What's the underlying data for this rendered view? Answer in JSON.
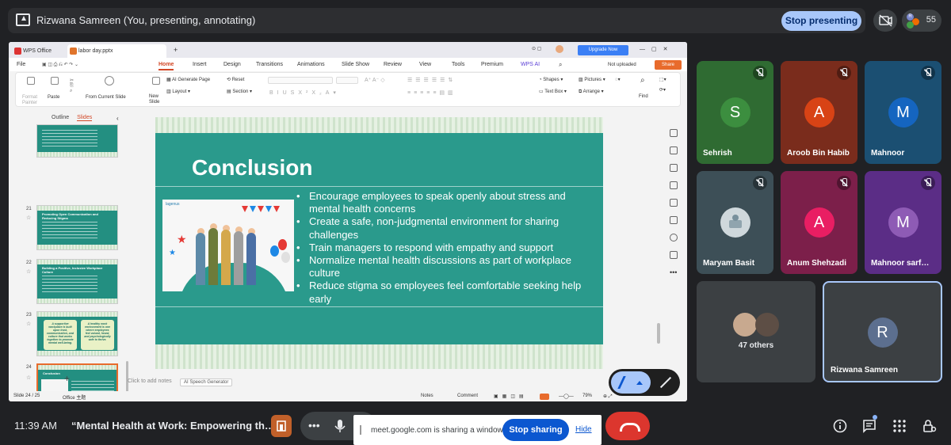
{
  "top": {
    "presenter_title": "Rizwana Samreen (You, presenting, annotating)",
    "stop_presenting": "Stop presenting",
    "participant_count": "55",
    "avatar_letter": "R"
  },
  "wps": {
    "tabs": [
      "WPS Office",
      "labor day.pptx"
    ],
    "upgrade": "Upgrade Now",
    "menu": [
      "File",
      "Home",
      "Insert",
      "Design",
      "Transitions",
      "Animations",
      "Slide Show",
      "Review",
      "View",
      "Tools",
      "Premium",
      "WPS AI"
    ],
    "not_uploaded": "Not uploaded",
    "share": "Share",
    "ribbon": {
      "format_painter": "Format Painter",
      "paste": "Paste",
      "from_current": "From Current Slide",
      "new_slide": "New Slide",
      "ai_generate": "AI Generate Page",
      "layout": "Layout",
      "reset": "Reset",
      "section": "Section",
      "shapes": "Shapes",
      "pictures": "Pictures",
      "text_box": "Text Box",
      "arrange": "Arrange",
      "find": "Find"
    },
    "panel_tabs": [
      "Outline",
      "Slides"
    ],
    "thumbs": [
      {
        "num": "21",
        "title": "Promoting Open Communication and Reducing Stigma"
      },
      {
        "num": "22",
        "title": "Building a Positive, Inclusive Workplace Culture"
      },
      {
        "num": "23",
        "q1": "A supportive workplace is built upon trust, communication, and culture that works together to promote mental well-being.",
        "q2": "A healthy work environment is one where employees feel valued, heard, and psychologically safe to thrive."
      },
      {
        "num": "24",
        "title": "Conclusion"
      }
    ],
    "notes_placeholder": "Click to add notes",
    "ai_speech": "AI Speech Generator",
    "status": {
      "slide": "Slide 24 / 25",
      "theme": "Office 主题",
      "notes": "Notes",
      "comment": "Comment",
      "zoom": "79%"
    }
  },
  "slide": {
    "title": "Conclusion",
    "bullets": [
      "Encourage employees to speak openly about stress and mental health concerns",
      "Create a safe, non-judgmental environment for sharing challenges",
      "Train managers to respond with empathy and support",
      "Normalize mental health discussions as part of workplace culture",
      "Reduce stigma so employees feel comfortable seeking help early"
    ],
    "illus_logo": "lagenus"
  },
  "tiles": [
    {
      "name": "Sehrish",
      "letter": "S",
      "bg": "#2f6b32",
      "av": "#3c8e3f"
    },
    {
      "name": "Aroob Bin Habib",
      "letter": "A",
      "bg": "#7a2c1c",
      "av": "#d84315"
    },
    {
      "name": "Mahnoor",
      "letter": "M",
      "bg": "#1b4f72",
      "av": "#1565c0"
    },
    {
      "name": "Maryam Basit",
      "letter": "",
      "bg": "#3d4f57",
      "av": "#cfd8dc"
    },
    {
      "name": "Anum Shehzadi",
      "letter": "A",
      "bg": "#7c1f4a",
      "av": "#e91e63"
    },
    {
      "name": "Mahnoor sarf…",
      "letter": "M",
      "bg": "#5b2d86",
      "av": "#8e5bb5"
    }
  ],
  "others": {
    "label": "47 others"
  },
  "self_tile": {
    "name": "Rizwana Samreen",
    "letter": "R"
  },
  "bottom": {
    "time": "11:39 AM",
    "meeting": "“Mental Health at Work: Empowering th…",
    "share_msg": "meet.google.com is sharing a window.",
    "stop_sharing": "Stop sharing",
    "hide": "Hide"
  },
  "colors": {
    "accent": "#a8c7fa",
    "end_call": "#dc362e",
    "slide_teal": "#2a9a8c",
    "wps_orange": "#d24726"
  }
}
